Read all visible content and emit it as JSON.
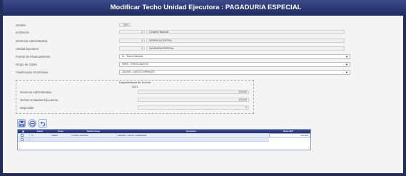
{
  "window": {
    "title": "Modificar Techo Unidad Ejecutora : PAGADURIA ESPECIAL"
  },
  "form": {
    "gestion": {
      "label": "Gestión",
      "value": "2021"
    },
    "institucion": {
      "label": "Institución",
      "code": "1",
      "text": "Congreso Nacional"
    },
    "gerencia": {
      "label": "Gerencia Administrativa",
      "code": "1",
      "text": "GERENCIA CENTRAL"
    },
    "unidad": {
      "label": "Unidad Ejecutora",
      "code": "1",
      "text": "PAGADURIA ESPECIAL"
    },
    "fuente": {
      "label": "Fuente de Financiamiento",
      "selected": "11 - Tesoro Nacional"
    },
    "grupo": {
      "label": "Grupo de Gasto",
      "selected": "90000 - OTROS GASTOS"
    },
    "clasificacion": {
      "label": "Clasificación Económica",
      "selected": "2100000 - GASTO CORRIENTE"
    }
  },
  "disponibilidad": {
    "title": "Disponibilidad de Techos",
    "year": "2021",
    "rows": [
      {
        "label": "Gerencia Administrativa",
        "value": "100,000"
      },
      {
        "label": "Techos Unidades Ejecutoras",
        "value": "100,000"
      },
      {
        "label": "Disponible",
        "value": "0"
      }
    ]
  },
  "toolbar": {
    "save_icon": "save-icon",
    "remove_icon": "remove-icon",
    "undo_icon": "undo-icon"
  },
  "grid": {
    "columns": [
      "",
      "Fuente",
      "Grupo",
      "Nombre Grupo",
      "Económico",
      "Monto 2021"
    ],
    "rows": [
      {
        "fuente": "11",
        "grupo": "90000",
        "nombre": "OTROS GASTOS",
        "economico": "2100000 - GASTO CORRIENTE",
        "monto": "100,000"
      }
    ],
    "scroll_left": "‹",
    "scroll_right": "›"
  },
  "colors": {
    "titlebar": "#1f2a62",
    "grid_header": "#24306a",
    "grid_row": "#e8eef9"
  }
}
